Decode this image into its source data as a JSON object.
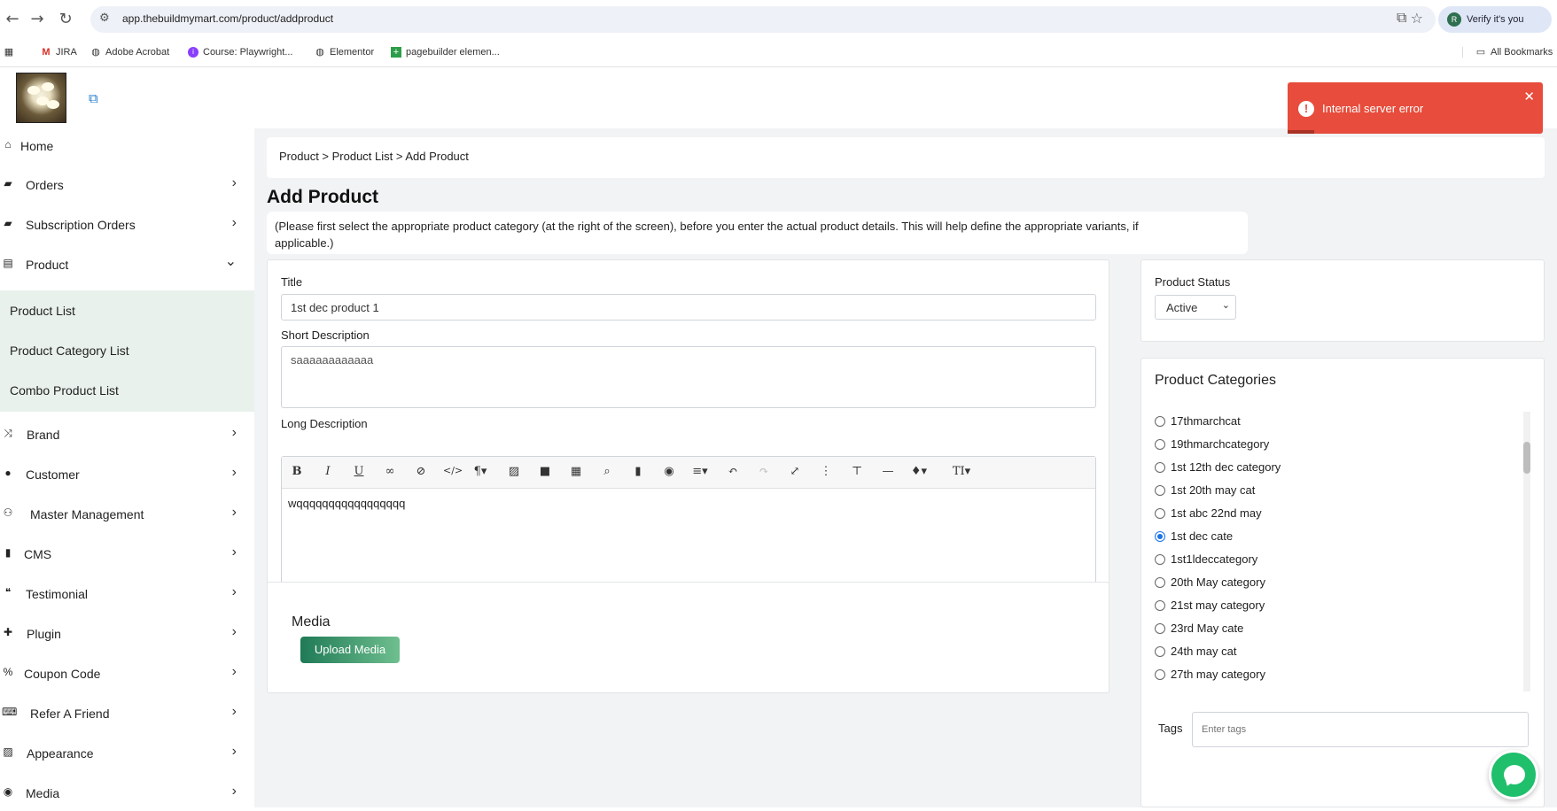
{
  "browser": {
    "url": "app.thebuildmymart.com/product/addproduct",
    "profile_label": "Verify it's you",
    "profile_initial": "R",
    "bookmarks": [
      "JIRA",
      "Adobe Acrobat",
      "Course: Playwright...",
      "Elementor",
      "pagebuilder elemen..."
    ],
    "all_bookmarks": "All Bookmarks"
  },
  "sidebar": {
    "items": [
      {
        "label": "Home",
        "icon": "home-icon",
        "chevron": ""
      },
      {
        "label": "Orders",
        "icon": "bag-icon",
        "chevron": "›"
      },
      {
        "label": "Subscription Orders",
        "icon": "bag-icon",
        "chevron": "›"
      },
      {
        "label": "Product",
        "icon": "box-icon",
        "chevron": "⌄"
      },
      {
        "label": "Brand",
        "icon": "shuffle-icon",
        "chevron": "›"
      },
      {
        "label": "Customer",
        "icon": "user-icon",
        "chevron": "›"
      },
      {
        "label": "Master Management",
        "icon": "users-cog-icon",
        "chevron": "›"
      },
      {
        "label": "CMS",
        "icon": "file-icon",
        "chevron": "›"
      },
      {
        "label": "Testimonial",
        "icon": "quote-icon",
        "chevron": "›"
      },
      {
        "label": "Plugin",
        "icon": "puzzle-icon",
        "chevron": "›"
      },
      {
        "label": "Coupon Code",
        "icon": "percent-icon",
        "chevron": "›"
      },
      {
        "label": "Refer A Friend",
        "icon": "keyboard-icon",
        "chevron": "›"
      },
      {
        "label": "Appearance",
        "icon": "image-icon",
        "chevron": "›"
      },
      {
        "label": "Media",
        "icon": "play-icon",
        "chevron": "›"
      }
    ],
    "product_submenu": [
      "Product List",
      "Product Category List",
      "Combo Product List"
    ]
  },
  "main": {
    "breadcrumb": "Product > Product List > Add Product",
    "title": "Add Product",
    "info": "(Please first select the appropriate product category (at the right of the screen), before you enter the actual product details. This will help define the appropriate variants, if applicable.)",
    "form": {
      "title_label": "Title",
      "title_value": "1st dec product 1",
      "short_desc_label": "Short Description",
      "short_desc_value": "saaaaaaaaaaaa",
      "long_desc_label": "Long Description",
      "long_desc_value": "wqqqqqqqqqqqqqqqqq"
    },
    "media": {
      "heading": "Media",
      "upload_label": "Upload Media"
    },
    "status": {
      "label": "Product Status",
      "value": "Active"
    },
    "categories": {
      "heading": "Product Categories",
      "selected": "1st dec cate",
      "items": [
        "17thmarchcat",
        "19thmarchcategory",
        "1st 12th dec category",
        "1st 20th may cat",
        "1st abc 22nd may",
        "1st dec cate",
        "1st1ldeccategory",
        "20th May category",
        "21st may category",
        "23rd May cate",
        "24th may cat",
        "27th may category"
      ]
    },
    "tags": {
      "label": "Tags",
      "placeholder": "Enter tags"
    }
  },
  "toast": {
    "message": "Internal server error",
    "color": "#e74c3c"
  },
  "colors": {
    "accent": "#1f7a56",
    "submenu_bg": "#e9f1ec"
  }
}
